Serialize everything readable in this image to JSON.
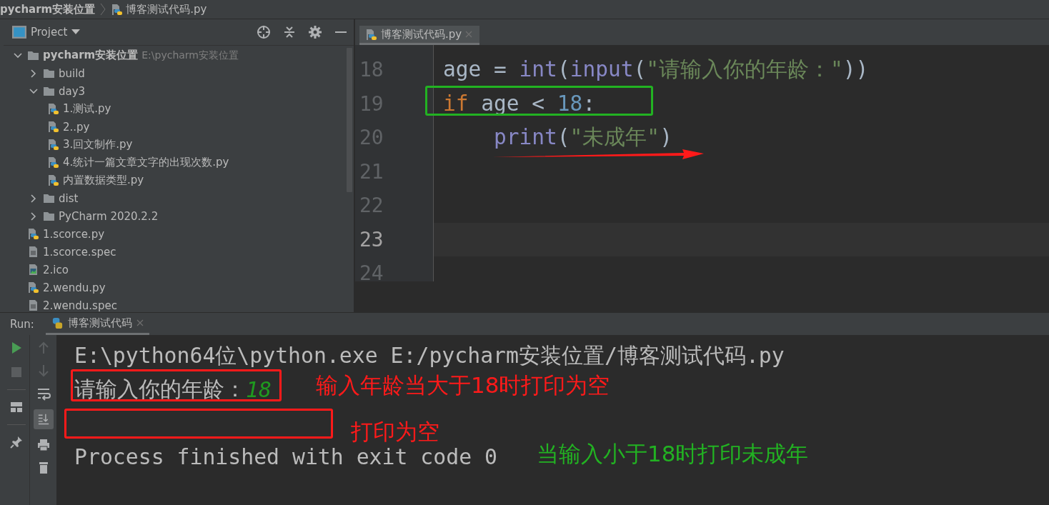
{
  "breadcrumb": [
    {
      "label": "pycharm安装位置",
      "kind": "folder"
    },
    {
      "label": "博客测试代码.py",
      "kind": "python"
    }
  ],
  "project_panel": {
    "title": "Project",
    "tree": [
      {
        "label": "pycharm安装位置",
        "path": "E:\\pycharm安装位置",
        "kind": "folder",
        "expanded": true,
        "children": [
          {
            "label": "build",
            "kind": "folder",
            "expanded": false
          },
          {
            "label": "day3",
            "kind": "folder",
            "expanded": true,
            "children": [
              {
                "label": "1.测试.py",
                "kind": "python"
              },
              {
                "label": "2..py",
                "kind": "python"
              },
              {
                "label": "3.回文制作.py",
                "kind": "python"
              },
              {
                "label": "4.统计一篇文章文字的出现次数.py",
                "kind": "python"
              },
              {
                "label": "内置数据类型.py",
                "kind": "python"
              }
            ]
          },
          {
            "label": "dist",
            "kind": "folder",
            "expanded": false
          },
          {
            "label": "PyCharm 2020.2.2",
            "kind": "folder",
            "expanded": false
          },
          {
            "label": "1.scorce.py",
            "kind": "python"
          },
          {
            "label": "1.scorce.spec",
            "kind": "text"
          },
          {
            "label": "2.ico",
            "kind": "image"
          },
          {
            "label": "2.wendu.py",
            "kind": "python"
          },
          {
            "label": "2.wendu.spec",
            "kind": "text"
          }
        ]
      }
    ]
  },
  "editor": {
    "tabs": [
      {
        "label": "博客测试代码.py",
        "selected": true
      }
    ],
    "lines": [
      {
        "number": "18",
        "current": false,
        "tokens": [
          {
            "text": "age",
            "kind": "name"
          },
          {
            "text": " = ",
            "kind": "plain"
          },
          {
            "text": "int",
            "kind": "builtin"
          },
          {
            "text": "(",
            "kind": "plain"
          },
          {
            "text": "input",
            "kind": "builtin"
          },
          {
            "text": "(",
            "kind": "plain"
          },
          {
            "text": "\"请输入你的年龄：\"",
            "kind": "string"
          },
          {
            "text": "))",
            "kind": "plain"
          }
        ]
      },
      {
        "number": "19",
        "current": false,
        "tokens": [
          {
            "text": "if",
            "kind": "keyword"
          },
          {
            "text": " age < ",
            "kind": "plain"
          },
          {
            "text": "18",
            "kind": "number"
          },
          {
            "text": ":",
            "kind": "plain"
          }
        ]
      },
      {
        "number": "20",
        "current": false,
        "indented": true,
        "tokens": [
          {
            "text": "print",
            "kind": "builtin"
          },
          {
            "text": "(",
            "kind": "plain"
          },
          {
            "text": "\"未成年\"",
            "kind": "string"
          },
          {
            "text": ")",
            "kind": "plain"
          }
        ]
      },
      {
        "number": "21",
        "current": false
      },
      {
        "number": "22",
        "current": false
      },
      {
        "number": "23",
        "current": true
      },
      {
        "number": "24",
        "current": false
      }
    ],
    "annotations": [
      {
        "kind": "box",
        "color": "#22b222"
      },
      {
        "kind": "arrow",
        "color": "#ff1a1a"
      }
    ]
  },
  "run_panel": {
    "label": "Run:",
    "tabs": [
      {
        "label": "博客测试代码",
        "selected": true
      }
    ],
    "console": [
      {
        "kind": "output",
        "segments": [
          {
            "text": "E:\\python64位\\python.exe E:/pycharm安装位置/博客测试代码.py",
            "kind": "output"
          }
        ]
      },
      {
        "kind": "output",
        "segments": [
          {
            "text": "请输入你的年龄：",
            "kind": "output"
          },
          {
            "text": "18",
            "kind": "input"
          }
        ]
      },
      {
        "kind": "blank"
      },
      {
        "kind": "output",
        "segments": [
          {
            "text": "Process finished with exit code 0",
            "kind": "output"
          }
        ]
      }
    ],
    "annotations": [
      {
        "kind": "box",
        "color": "#ff1a1a"
      },
      {
        "kind": "text",
        "text": "输入年龄当大于18时打印为空",
        "color": "#ff1a1a"
      },
      {
        "kind": "box",
        "color": "#ff1a1a"
      },
      {
        "kind": "text",
        "text": "打印为空",
        "color": "#ff1a1a"
      },
      {
        "kind": "text",
        "text": "当输入小于18时打印未成年",
        "color": "#22b222"
      }
    ]
  }
}
